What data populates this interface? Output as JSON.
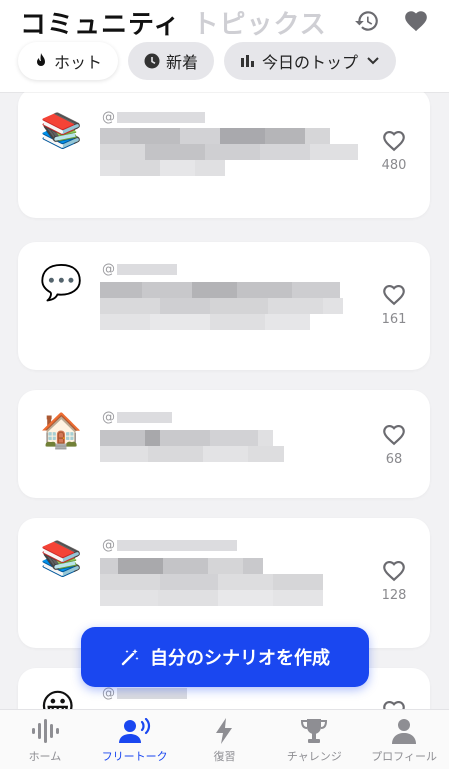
{
  "header": {
    "title_active": "コミュニティ",
    "title_inactive": "トピックス",
    "history_icon": "history-icon",
    "heart_icon": "heart-icon"
  },
  "filters": [
    {
      "label": "ホット",
      "icon": "flame-icon",
      "active": true
    },
    {
      "label": "新着",
      "icon": "clock-icon",
      "active": false
    },
    {
      "label": "今日のトップ",
      "icon": "bar-chart-icon",
      "active": false
    }
  ],
  "posts": [
    {
      "emoji": "📚",
      "handle": "@",
      "likes": "480"
    },
    {
      "emoji": "💬",
      "handle": "@",
      "likes": "161"
    },
    {
      "emoji": "🏠",
      "handle": "@",
      "likes": "68"
    },
    {
      "emoji": "📚",
      "handle": "@",
      "likes": "128"
    },
    {
      "emoji": "😀",
      "handle": "@",
      "likes": ""
    }
  ],
  "fab": {
    "label": "自分のシナリオを作成",
    "icon": "magic-wand-icon"
  },
  "tabs": [
    {
      "label": "ホーム",
      "icon": "waveform-icon",
      "active": false
    },
    {
      "label": "フリートーク",
      "icon": "speaking-person-icon",
      "active": true
    },
    {
      "label": "復習",
      "icon": "lightning-icon",
      "active": false
    },
    {
      "label": "チャレンジ",
      "icon": "trophy-icon",
      "active": false
    },
    {
      "label": "プロフィール",
      "icon": "person-icon",
      "active": false
    }
  ],
  "colors": {
    "accent": "#1a47f0",
    "background": "#f2f2f4",
    "card": "#ffffff"
  }
}
